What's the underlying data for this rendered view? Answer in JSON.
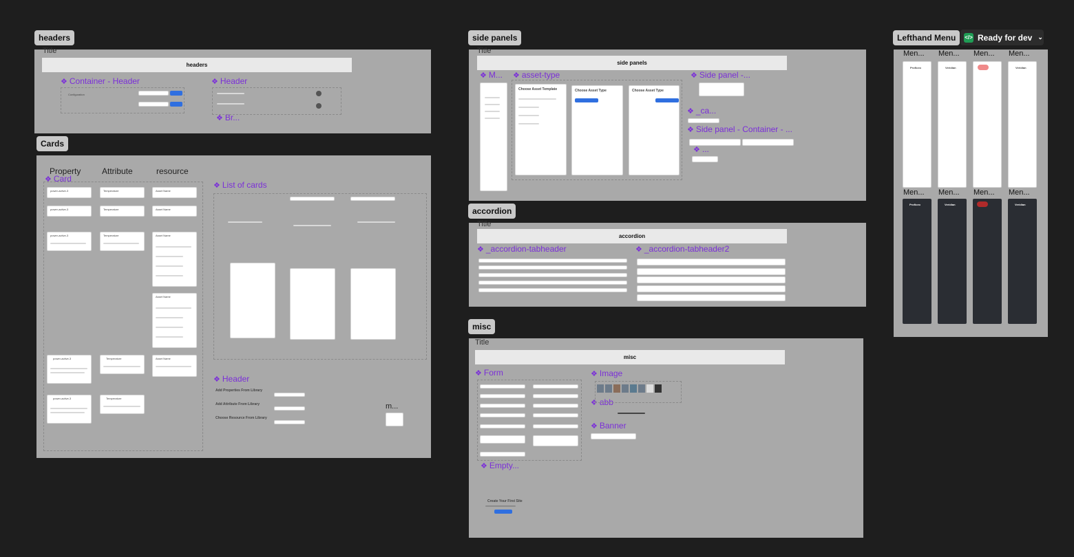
{
  "tags": {
    "headers": "headers",
    "cards": "Cards",
    "side_panels": "side panels",
    "accordion": "accordion",
    "misc": "misc",
    "lefthand_menu": "Lefthand Menu",
    "ready": "Ready for dev"
  },
  "headers_frame": {
    "title": "Title",
    "bar": "headers",
    "container_header": "Container - Header",
    "header": "Header",
    "br": "Br...",
    "configuration": "Configuration"
  },
  "cards_frame": {
    "col_property": "Property",
    "col_attribute": "Attribute",
    "col_resource": "resource",
    "card": "Card",
    "list_of_cards": "List of cards",
    "header": "Header",
    "m": "m...",
    "add_properties": "Add Properties From Library",
    "add_attribute": "Add Attribute From Library",
    "choose_resource": "Choose Resource From Library",
    "item_power": "power-active-3",
    "item_temp": "Temperature",
    "item_asset": "Asset Name"
  },
  "side_panels_frame": {
    "title": "Title",
    "bar": "side panels",
    "m": "M...",
    "asset_type": "asset-type",
    "side_panel": "Side panel -...",
    "ca": "_ca...",
    "container": "Side panel - Container - ...",
    "dotdot": "...",
    "choose_template": "Choose Asset Template",
    "choose_type": "Choose Asset Type",
    "choose_type2": "Choose Asset Type"
  },
  "accordion_frame": {
    "title": "Title",
    "bar": "accordion",
    "tabheader": "_accordion-tabheader",
    "tabheader2": "_accordion-tabheader2"
  },
  "misc_frame": {
    "title": "Title",
    "bar": "misc",
    "form": "Form",
    "image": "Image",
    "abb": "abb",
    "banner": "Banner",
    "empty": "Empty...",
    "create_site": "Create Your First Site"
  },
  "lefthand_frame": {
    "men": "Men...",
    "brand_proficeo": "Proficeo",
    "brand_veridian": "Veridian"
  },
  "colors": {
    "canvas": "#1e1e1e",
    "frame": "#a9a9a9",
    "component": "#7b2fd8",
    "primary": "#2f6fe0",
    "ready_icon": "#1f9d55"
  }
}
